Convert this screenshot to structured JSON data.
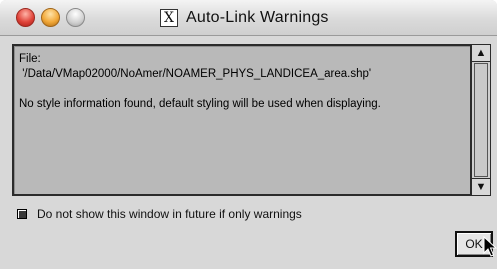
{
  "window": {
    "title": "Auto-Link Warnings",
    "title_icon_glyph": "X"
  },
  "message": {
    "line1": "File:",
    "line2": " '/Data/VMap02000/NoAmer/NOAMER_PHYS_LANDICEA_area.shp'",
    "line3": "",
    "line4": "No style information found, default styling will be used when displaying."
  },
  "scrollbar": {
    "up_glyph": "▲",
    "down_glyph": "▼"
  },
  "options": {
    "no_show_label": "Do not show this window in future if only warnings",
    "no_show_checked": false
  },
  "buttons": {
    "ok_label": "OK"
  },
  "colors": {
    "window_bg": "#d8d8d8",
    "message_bg": "#b9b9b9",
    "close": "#e0443a",
    "minimize": "#f2a93a",
    "zoom": "#cfcfcf"
  },
  "icons": {
    "close": "close-icon",
    "minimize": "minimize-icon",
    "zoom": "zoom-icon",
    "title": "x-window-icon",
    "cursor": "mouse-cursor-icon"
  }
}
